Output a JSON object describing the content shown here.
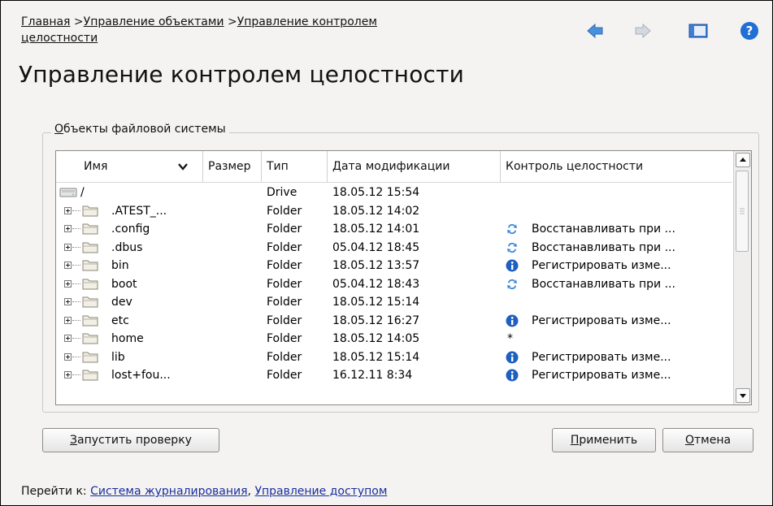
{
  "breadcrumb": {
    "items": [
      {
        "label": "Главная"
      },
      {
        "label": "Управление объектами"
      },
      {
        "label": "Управление контролем"
      },
      {
        "label": "целостности"
      }
    ],
    "separator": " >"
  },
  "page_title": "Управление контролем целостности",
  "nav": {
    "back_icon": "arrow-left-icon",
    "forward_icon": "arrow-right-icon",
    "window_icon": "window-icon",
    "help_icon": "help-icon"
  },
  "group": {
    "title_first": "О",
    "title_rest": "бъекты файловой системы"
  },
  "table": {
    "columns": [
      "Имя",
      "Размер",
      "Тип",
      "Дата модификации",
      "Контроль целостности"
    ],
    "rows": [
      {
        "name": "/",
        "size": "",
        "type": "Drive",
        "date": "18.05.12 15:54",
        "control": "",
        "icon": "drive-icon",
        "control_icon": ""
      },
      {
        "name": ".ATEST_...",
        "size": "",
        "type": "Folder",
        "date": "18.05.12 14:02",
        "control": "",
        "icon": "folder-icon",
        "control_icon": ""
      },
      {
        "name": ".config",
        "size": "",
        "type": "Folder",
        "date": "18.05.12 14:01",
        "control": "Восстанавливать при ...",
        "icon": "folder-icon",
        "control_icon": "restore-icon"
      },
      {
        "name": ".dbus",
        "size": "",
        "type": "Folder",
        "date": "05.04.12 18:45",
        "control": "Восстанавливать при ...",
        "icon": "folder-icon",
        "control_icon": "restore-icon"
      },
      {
        "name": "bin",
        "size": "",
        "type": "Folder",
        "date": "18.05.12 13:57",
        "control": "Регистрировать изме...",
        "icon": "folder-icon",
        "control_icon": "info-icon"
      },
      {
        "name": "boot",
        "size": "",
        "type": "Folder",
        "date": "05.04.12 18:43",
        "control": "Восстанавливать при ...",
        "icon": "folder-icon",
        "control_icon": "restore-icon"
      },
      {
        "name": "dev",
        "size": "",
        "type": "Folder",
        "date": "18.05.12 15:14",
        "control": "",
        "icon": "folder-icon",
        "control_icon": ""
      },
      {
        "name": "etc",
        "size": "",
        "type": "Folder",
        "date": "18.05.12 16:27",
        "control": "Регистрировать изме...",
        "icon": "folder-icon",
        "control_icon": "info-icon"
      },
      {
        "name": "home",
        "size": "",
        "type": "Folder",
        "date": "18.05.12 14:05",
        "control": "*",
        "icon": "folder-icon",
        "control_icon": ""
      },
      {
        "name": "lib",
        "size": "",
        "type": "Folder",
        "date": "18.05.12 15:14",
        "control": "Регистрировать изме...",
        "icon": "folder-icon",
        "control_icon": "info-icon"
      },
      {
        "name": "lost+fou...",
        "size": "",
        "type": "Folder",
        "date": "16.12.11 8:34",
        "control": "Регистрировать изме...",
        "icon": "folder-icon",
        "control_icon": "info-icon"
      }
    ]
  },
  "buttons": {
    "run_check_first": "З",
    "run_check_rest": "апустить проверку",
    "apply_first": "П",
    "apply_rest": "рименить",
    "cancel_first": "О",
    "cancel_rest": "тмена"
  },
  "goto": {
    "prefix": "Перейти к: ",
    "links": [
      "Система журналирования",
      "Управление доступом"
    ],
    "separator": ", "
  },
  "colors": {
    "link": "#1a2e9c",
    "nav_arrow_active": "#4a8fdc",
    "nav_arrow_inactive": "#b9c2cc",
    "help": "#1f6fd6",
    "restore": "#3a88d8",
    "info": "#1f5fbf"
  }
}
